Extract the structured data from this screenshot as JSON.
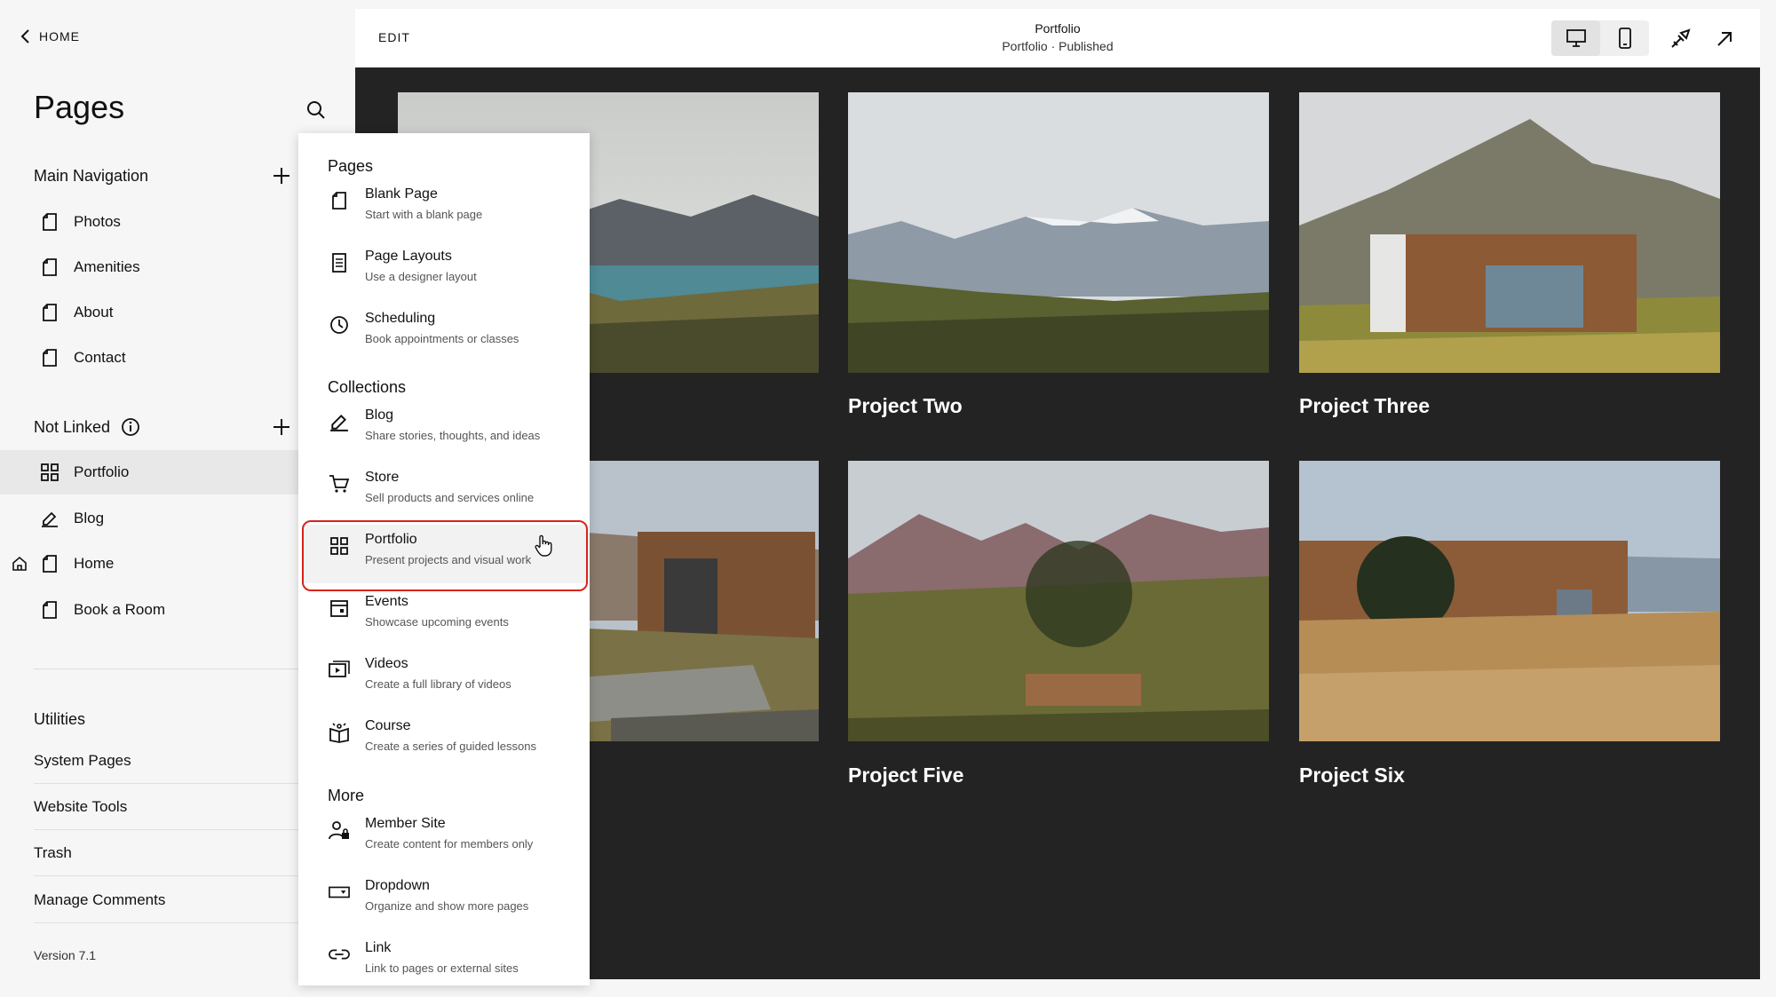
{
  "sidebar": {
    "home_label": "HOME",
    "title": "Pages",
    "main_nav": {
      "heading": "Main Navigation",
      "items": [
        {
          "label": "Photos",
          "icon": "page-icon"
        },
        {
          "label": "Amenities",
          "icon": "page-icon"
        },
        {
          "label": "About",
          "icon": "page-icon"
        },
        {
          "label": "Contact",
          "icon": "page-icon"
        }
      ]
    },
    "not_linked": {
      "heading": "Not Linked",
      "items": [
        {
          "label": "Portfolio",
          "icon": "grid-icon",
          "active": true
        },
        {
          "label": "Blog",
          "icon": "blog-icon"
        },
        {
          "label": "Home",
          "icon": "page-icon",
          "is_homepage": true
        },
        {
          "label": "Book a Room",
          "icon": "page-icon"
        }
      ]
    },
    "utilities": {
      "heading": "Utilities",
      "items": [
        "System Pages",
        "Website Tools",
        "Trash",
        "Manage Comments"
      ]
    },
    "version": "Version 7.1"
  },
  "topbar": {
    "edit_label": "EDIT",
    "title": "Portfolio",
    "subtitle": "Portfolio · Published",
    "view_mode": "desktop"
  },
  "projects": [
    {
      "title": "Project Two"
    },
    {
      "title": "Project Three"
    },
    {
      "title": "Project Five"
    },
    {
      "title": "Project Six"
    }
  ],
  "menu": {
    "sections": [
      {
        "heading": "Pages",
        "items": [
          {
            "title": "Blank Page",
            "desc": "Start with a blank page",
            "icon": "page-icon"
          },
          {
            "title": "Page Layouts",
            "desc": "Use a designer layout",
            "icon": "layout-icon"
          },
          {
            "title": "Scheduling",
            "desc": "Book appointments or classes",
            "icon": "clock-icon"
          }
        ]
      },
      {
        "heading": "Collections",
        "items": [
          {
            "title": "Blog",
            "desc": "Share stories, thoughts, and ideas",
            "icon": "blog-icon"
          },
          {
            "title": "Store",
            "desc": "Sell products and services online",
            "icon": "cart-icon"
          },
          {
            "title": "Portfolio",
            "desc": "Present projects and visual work",
            "icon": "grid-icon",
            "highlighted": true
          },
          {
            "title": "Events",
            "desc": "Showcase upcoming events",
            "icon": "calendar-icon"
          },
          {
            "title": "Videos",
            "desc": "Create a full library of videos",
            "icon": "video-icon"
          },
          {
            "title": "Course",
            "desc": "Create a series of guided lessons",
            "icon": "course-icon"
          }
        ]
      },
      {
        "heading": "More",
        "items": [
          {
            "title": "Member Site",
            "desc": "Create content for members only",
            "icon": "member-icon"
          },
          {
            "title": "Dropdown",
            "desc": "Organize and show more pages",
            "icon": "dropdown-icon"
          },
          {
            "title": "Link",
            "desc": "Link to pages or external sites",
            "icon": "link-icon"
          }
        ]
      }
    ]
  },
  "colors": {
    "highlight_border": "#d9241c",
    "canvas_bg": "#232323",
    "sidebar_bg": "#f6f6f6"
  }
}
